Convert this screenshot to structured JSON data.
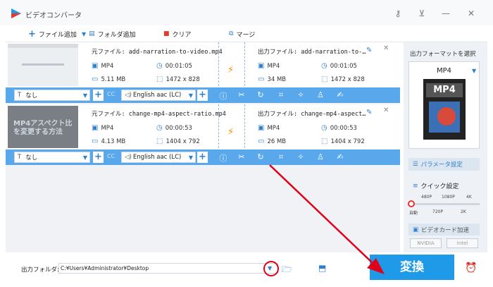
{
  "window": {
    "title": "ビデオコンバータ"
  },
  "toolbar": {
    "add_file": "ファイル追加",
    "add_folder": "フォルダ追加",
    "clear": "クリア",
    "merge": "マージ"
  },
  "items": [
    {
      "source_name": "元ファイル: add-narration-to-video.mp4",
      "source_format": "MP4",
      "source_duration": "00:01:05",
      "source_size": "5.11 MB",
      "source_resolution": "1472 x 828",
      "output_name": "出力ファイル: add-narration-to-…",
      "output_format": "MP4",
      "output_duration": "00:01:05",
      "output_size": "34 MB",
      "output_resolution": "1472 x 828",
      "subtitle": "なし",
      "audio": "English aac (LC)"
    },
    {
      "source_name": "元ファイル: change-mp4-aspect-ratio.mp4",
      "source_format": "MP4",
      "source_duration": "00:00:53",
      "source_size": "4.13 MB",
      "source_resolution": "1404 x 792",
      "output_name": "出力ファイル: change-mp4-aspect…",
      "output_format": "MP4",
      "output_duration": "00:00:53",
      "output_size": "26 MB",
      "output_resolution": "1404 x 792",
      "subtitle": "なし",
      "audio": "English aac (LC)",
      "thumb_text": "MP4アスペクト比を変更する方法"
    }
  ],
  "right_panel": {
    "select_format_label": "出力フォーマットを選択",
    "format": "MP4",
    "format_badge": "MP4",
    "param_label": "パラメータ設定",
    "quick_label": "クイック設定",
    "q_top": [
      "480P",
      "1080P",
      "4K"
    ],
    "q_bottom": [
      "自動",
      "720P",
      "2K"
    ],
    "gpu_label": "ビデオカード加速",
    "gpu": [
      "NVIDIA",
      "Intel"
    ]
  },
  "bottom": {
    "out_label": "出力フォルダ:",
    "out_path": "C:¥Users¥Administrator¥Desktop",
    "convert": "変換"
  },
  "colors": {
    "accent": "#1e9ae8",
    "bar": "#5aa8ec",
    "bolt": "#ff8a00",
    "highlight": "#e0001a"
  }
}
